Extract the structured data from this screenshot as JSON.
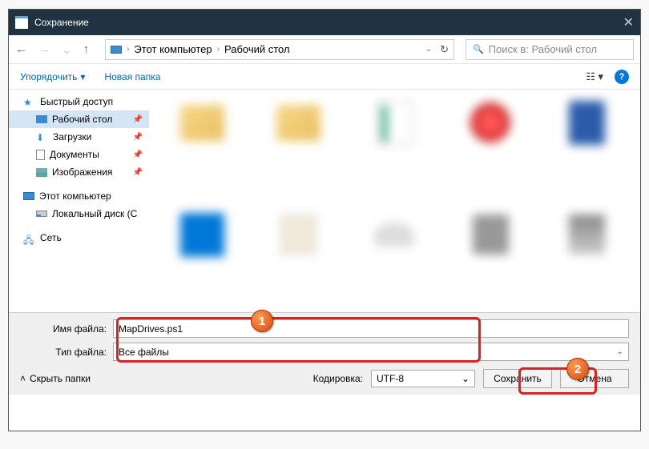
{
  "title": "Сохранение",
  "nav": {
    "pc": "Этот компьютер",
    "desktop": "Рабочий стол",
    "search_placeholder": "Поиск в: Рабочий стол"
  },
  "toolbar": {
    "organize": "Упорядочить",
    "new_folder": "Новая папка"
  },
  "sidebar": {
    "quick": "Быстрый доступ",
    "desktop": "Рабочий стол",
    "downloads": "Загрузки",
    "documents": "Документы",
    "pictures": "Изображения",
    "this_pc": "Этот компьютер",
    "local_disk": "Локальный диск (C",
    "network": "Сеть"
  },
  "fields": {
    "filename_label": "Имя файла:",
    "filename_value": "MapDrives.ps1",
    "filetype_label": "Тип файла:",
    "filetype_value": "Все файлы"
  },
  "actions": {
    "hide_folders": "Скрыть папки",
    "encoding_label": "Кодировка:",
    "encoding_value": "UTF-8",
    "save": "Сохранить",
    "cancel": "Отмена"
  },
  "badges": {
    "one": "1",
    "two": "2"
  }
}
